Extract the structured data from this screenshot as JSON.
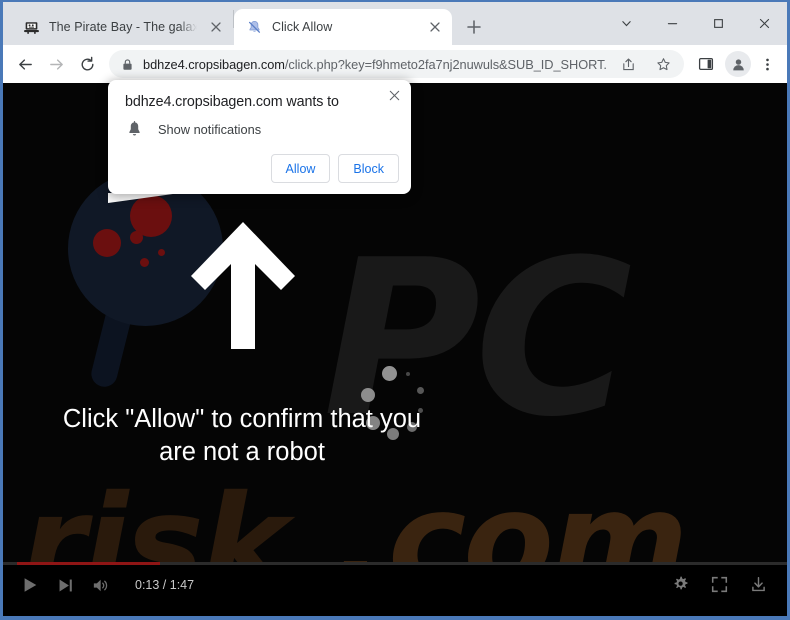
{
  "window": {
    "controls": [
      {
        "name": "tab-search-chevron",
        "icon": "chevron-down-icon"
      },
      {
        "name": "minimize",
        "icon": "minimize-icon"
      },
      {
        "name": "maximize",
        "icon": "maximize-icon"
      },
      {
        "name": "close",
        "icon": "close-icon"
      }
    ]
  },
  "tabs": [
    {
      "title": "The Pirate Bay - The galaxy's mos",
      "favicon": "pirate-ship-icon",
      "active": false
    },
    {
      "title": "Click Allow",
      "favicon": "bell-blocked-icon",
      "active": true
    }
  ],
  "newtab_label": "+",
  "toolbar": {
    "back_icon": "arrow-back-icon",
    "forward_icon": "arrow-forward-icon",
    "reload_icon": "reload-icon",
    "lock_icon": "lock-icon",
    "url_host": "bdhze4.cropsibagen.com",
    "url_path": "/click.php?key=f9hmeto2fa7nj2nuwuls&SUB_ID_SHORT...",
    "url_full": "bdhze4.cropsibagen.com/click.php?key=f9hmeto2fa7nj2nuwuls&SUB_ID_SHORT...",
    "share_icon": "share-icon",
    "bookmark_icon": "star-icon",
    "sidepanel_icon": "side-panel-icon",
    "profile_icon": "avatar-icon",
    "menu_icon": "three-dot-menu-icon"
  },
  "permission_dialog": {
    "title": "bdhze4.cropsibagen.com wants to",
    "permission_icon": "bell-icon",
    "permission_label": "Show notifications",
    "allow_label": "Allow",
    "block_label": "Block",
    "close_icon": "close-icon"
  },
  "page": {
    "message_line1": "Click \"Allow\" to confirm that you",
    "message_line2": "are not a robot",
    "watermark_pc": "PC",
    "watermark_dot": ".",
    "watermark_risk": "risk",
    "watermark_com": "com",
    "graphics": {
      "magnifier": "magnifying-glass-icon",
      "arrow": "up-arrow-icon",
      "spinner": "loading-spinner-icon"
    }
  },
  "video_controls": {
    "play_icon": "play-icon",
    "next_icon": "next-track-icon",
    "volume_icon": "volume-icon",
    "time_current": "0:13",
    "time_total": "1:47",
    "time_display": "0:13 / 1:47",
    "settings_icon": "gear-icon",
    "fullscreen_icon": "fullscreen-icon",
    "download_icon": "download-icon",
    "progress_percent": 20
  },
  "colors": {
    "window_border": "#4a79b8",
    "tabstrip_bg": "#dee1e6",
    "toolbar_bg": "#ffffff",
    "omnibox_bg": "#f1f3f4",
    "accent_blue": "#1a73e8",
    "page_bg": "#000000",
    "progress_red": "#8f1515"
  }
}
